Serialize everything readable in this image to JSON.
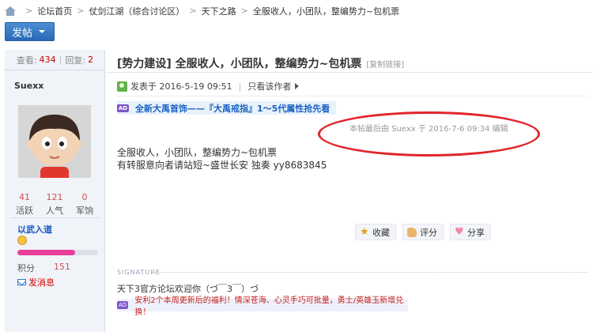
{
  "breadcrumb": {
    "items": [
      "论坛首页",
      "仗剑江湖（综合讨论区）",
      "天下之路",
      "全服收人，小团队，整编势力~包机票"
    ],
    "separator": ">"
  },
  "toolbar": {
    "post_label": "发帖"
  },
  "post_stats": {
    "views_label": "查看:",
    "views": "434",
    "divider": "|",
    "replies_label": "回复:",
    "replies": "2"
  },
  "author": {
    "name": "Suexx",
    "stats": [
      {
        "value": "41",
        "label": "活跃"
      },
      {
        "value": "121",
        "label": "人气"
      },
      {
        "value": "0",
        "label": "军饷"
      }
    ],
    "rank": "以武入道",
    "progress_fraction": 0.72,
    "score_label": "积分",
    "score": "151",
    "message_label": "发消息"
  },
  "post": {
    "title": "[势力建设] 全服收人，小团队，整编势力~包机票",
    "copy_link": "[复制链接]",
    "posted": "发表于 2016-5-19 09:51",
    "author_only": "只看该作者",
    "ad_top_badge": "AD",
    "ad_top": "全新大禹首饰——『大禹戒指』1～5代属性抢先看",
    "edited": "本帖最后由 Suexx 于 2016-7-6 09:34 编辑",
    "content_lines": [
      "全服收人，小团队，整编势力~包机票",
      "有转服意向者请站短~盛世长安 独奏 yy8683845"
    ],
    "actions": {
      "favorite": "收藏",
      "rate": "评分",
      "share": "分享"
    },
    "signature_label": "SIGNATURE",
    "signature": "天下3官方论坛欢迎你（づ￣3￣）づ",
    "ad_bottom_badge": "AD",
    "ad_bottom": "安利2个本周更新后的福利！情深苍海、心灵手巧可批量，勇士/英雄玉新增兑换！"
  },
  "colors": {
    "accent_blue": "#2868b7",
    "link_blue": "#1b62c4",
    "highlight_red": "#e0262a"
  }
}
